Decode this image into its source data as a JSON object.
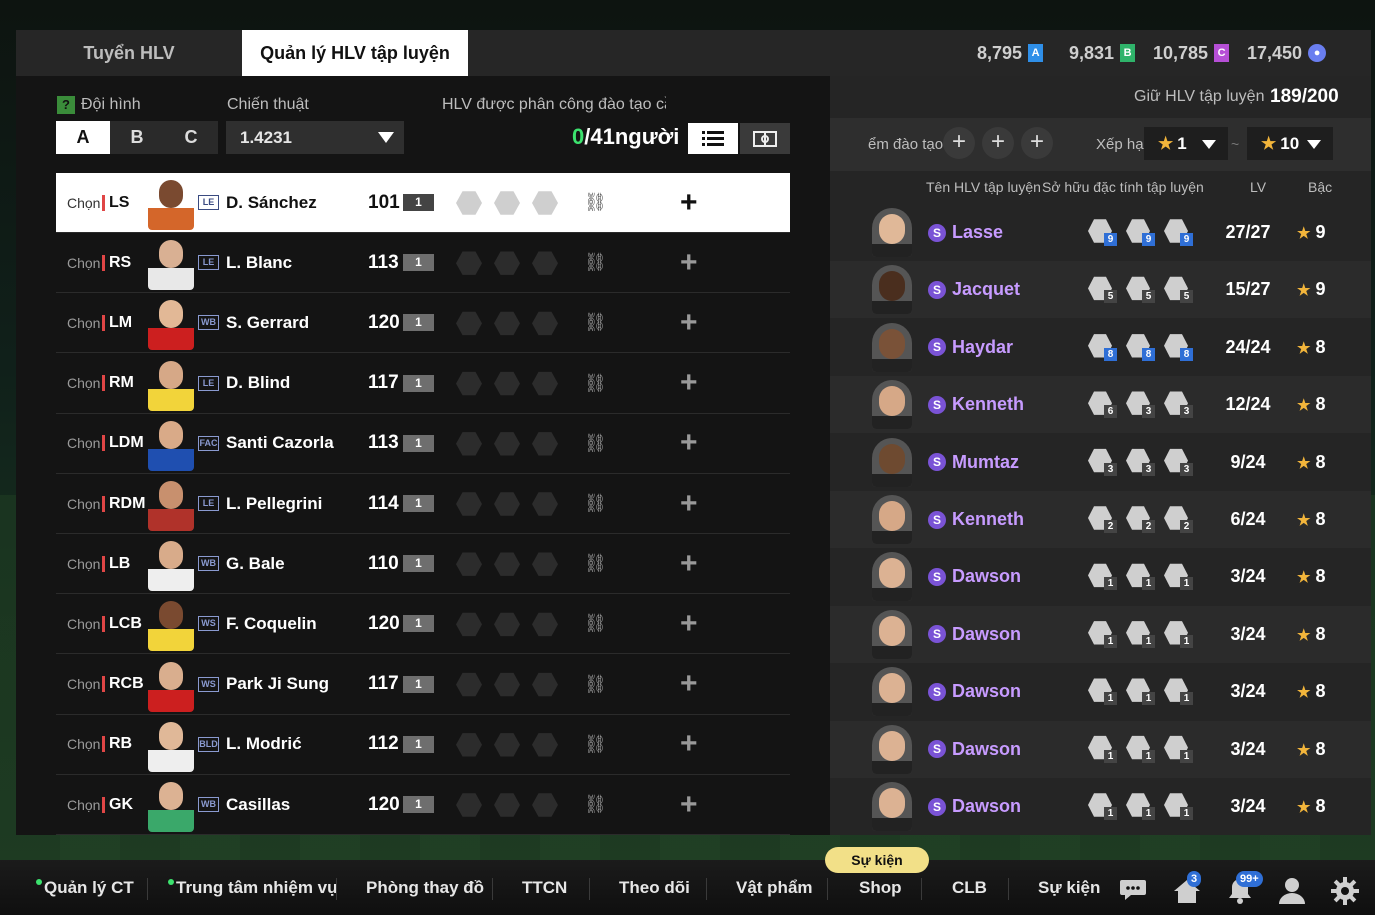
{
  "tabs": {
    "recruit": "Tuyển HLV",
    "manage": "Quản lý HLV tập luyện"
  },
  "currencies": [
    {
      "value": "8,795",
      "icon": "A",
      "color": "#2f8fe8"
    },
    {
      "value": "9,831",
      "icon": "B",
      "color": "#2fb36a"
    },
    {
      "value": "10,785",
      "icon": "C",
      "color": "#b64fd6"
    },
    {
      "value": "17,450",
      "icon": "coin",
      "color": "#6a7ef0"
    }
  ],
  "left": {
    "lineup_label": "Đội hình",
    "help_icon": "?",
    "tactic_label": "Chiến thuật",
    "assigned_label": "HLV được phân công đào tạo cầu t",
    "squads": [
      "A",
      "B",
      "C"
    ],
    "tactic_value": "1.4231",
    "count_assigned": "0",
    "count_total": "/41người"
  },
  "players": [
    {
      "chon": "Chọn",
      "pos": "LS",
      "season": "LE",
      "name": "D. Sánchez",
      "ovr": "101",
      "lvl": "1",
      "jersey": "#d4662a",
      "skin": "#7a4a30"
    },
    {
      "chon": "Chọn",
      "pos": "RS",
      "season": "LE",
      "name": "L. Blanc",
      "ovr": "113",
      "lvl": "1",
      "jersey": "#e8e8e8",
      "skin": "#d9b093"
    },
    {
      "chon": "Chọn",
      "pos": "LM",
      "season": "WB",
      "name": "S. Gerrard",
      "ovr": "120",
      "lvl": "1",
      "jersey": "#cc1f1f",
      "skin": "#e2b896"
    },
    {
      "chon": "Chọn",
      "pos": "RM",
      "season": "LE",
      "name": "D. Blind",
      "ovr": "117",
      "lvl": "1",
      "jersey": "#f2d43a",
      "skin": "#d6a887"
    },
    {
      "chon": "Chọn",
      "pos": "LDM",
      "season": "FAC",
      "name": "Santi Cazorla",
      "ovr": "113",
      "lvl": "1",
      "jersey": "#1f4fb0",
      "skin": "#d9aa88"
    },
    {
      "chon": "Chọn",
      "pos": "RDM",
      "season": "LE",
      "name": "L. Pellegrini",
      "ovr": "114",
      "lvl": "1",
      "jersey": "#b0322a",
      "skin": "#c8906e"
    },
    {
      "chon": "Chọn",
      "pos": "LB",
      "season": "WB",
      "name": "G. Bale",
      "ovr": "110",
      "lvl": "1",
      "jersey": "#eeeeee",
      "skin": "#d8ab8a"
    },
    {
      "chon": "Chọn",
      "pos": "LCB",
      "season": "WS",
      "name": "F. Coquelin",
      "ovr": "120",
      "lvl": "1",
      "jersey": "#f2d43a",
      "skin": "#7a4a30"
    },
    {
      "chon": "Chọn",
      "pos": "RCB",
      "season": "WS",
      "name": "Park Ji Sung",
      "ovr": "117",
      "lvl": "1",
      "jersey": "#cc1f1f",
      "skin": "#d9ae8e"
    },
    {
      "chon": "Chọn",
      "pos": "RB",
      "season": "BLD",
      "name": "L. Modrić",
      "ovr": "112",
      "lvl": "1",
      "jersey": "#eeeeee",
      "skin": "#e0b898"
    },
    {
      "chon": "Chọn",
      "pos": "GK",
      "season": "WB",
      "name": "Casillas",
      "ovr": "120",
      "lvl": "1",
      "jersey": "#3aa86a",
      "skin": "#dcb293"
    }
  ],
  "right": {
    "hold_label": "Giữ HLV tập luyện",
    "hold_value": "189/200",
    "training_label": "ểm đào tạo",
    "rank_label": "Xếp hạ",
    "star_from": "1",
    "star_to": "10",
    "tilde": "~",
    "col_name": "Tên HLV tập luyện",
    "col_traits": "Sở hữu đặc tính tập luyện",
    "col_lv": "LV",
    "col_bac": "Bậc"
  },
  "coaches": [
    {
      "name": "Lasse",
      "traits": [
        "9",
        "9",
        "9"
      ],
      "blue": true,
      "lv": "27/27",
      "bac": "9",
      "skin": "#e0b898"
    },
    {
      "name": "Jacquet",
      "traits": [
        "5",
        "5",
        "5"
      ],
      "blue": false,
      "lv": "15/27",
      "bac": "9",
      "skin": "#4a2e1e"
    },
    {
      "name": "Haydar",
      "traits": [
        "8",
        "8",
        "8"
      ],
      "blue": true,
      "lv": "24/24",
      "bac": "8",
      "skin": "#7a5238"
    },
    {
      "name": "Kenneth",
      "traits": [
        "6",
        "3",
        "3"
      ],
      "blue": false,
      "lv": "12/24",
      "bac": "8",
      "skin": "#d6a887"
    },
    {
      "name": "Mumtaz",
      "traits": [
        "3",
        "3",
        "3"
      ],
      "blue": false,
      "lv": "9/24",
      "bac": "8",
      "skin": "#6e4a30"
    },
    {
      "name": "Kenneth",
      "traits": [
        "2",
        "2",
        "2"
      ],
      "blue": false,
      "lv": "6/24",
      "bac": "8",
      "skin": "#d6a887"
    },
    {
      "name": "Dawson",
      "traits": [
        "1",
        "1",
        "1"
      ],
      "blue": false,
      "lv": "3/24",
      "bac": "8",
      "skin": "#dcb293"
    },
    {
      "name": "Dawson",
      "traits": [
        "1",
        "1",
        "1"
      ],
      "blue": false,
      "lv": "3/24",
      "bac": "8",
      "skin": "#dcb293"
    },
    {
      "name": "Dawson",
      "traits": [
        "1",
        "1",
        "1"
      ],
      "blue": false,
      "lv": "3/24",
      "bac": "8",
      "skin": "#dcb293"
    },
    {
      "name": "Dawson",
      "traits": [
        "1",
        "1",
        "1"
      ],
      "blue": false,
      "lv": "3/24",
      "bac": "8",
      "skin": "#dcb293"
    },
    {
      "name": "Dawson",
      "traits": [
        "1",
        "1",
        "1"
      ],
      "blue": false,
      "lv": "3/24",
      "bac": "8",
      "skin": "#dcb293"
    }
  ],
  "bottom_nav": [
    "Quản lý CT",
    "Trung tâm nhiệm vụ",
    "Phòng thay đồ",
    "TTCN",
    "Theo dõi",
    "Vật phẩm",
    "Shop",
    "CLB",
    "Sự kiện"
  ],
  "event_pill": "Sự kiện",
  "icons": {
    "chat": "chat-icon",
    "home": "home-icon",
    "bell": "bell-icon",
    "profile": "profile-icon",
    "gear": "gear-icon"
  },
  "badges": {
    "home": "3",
    "bell": "99+"
  }
}
